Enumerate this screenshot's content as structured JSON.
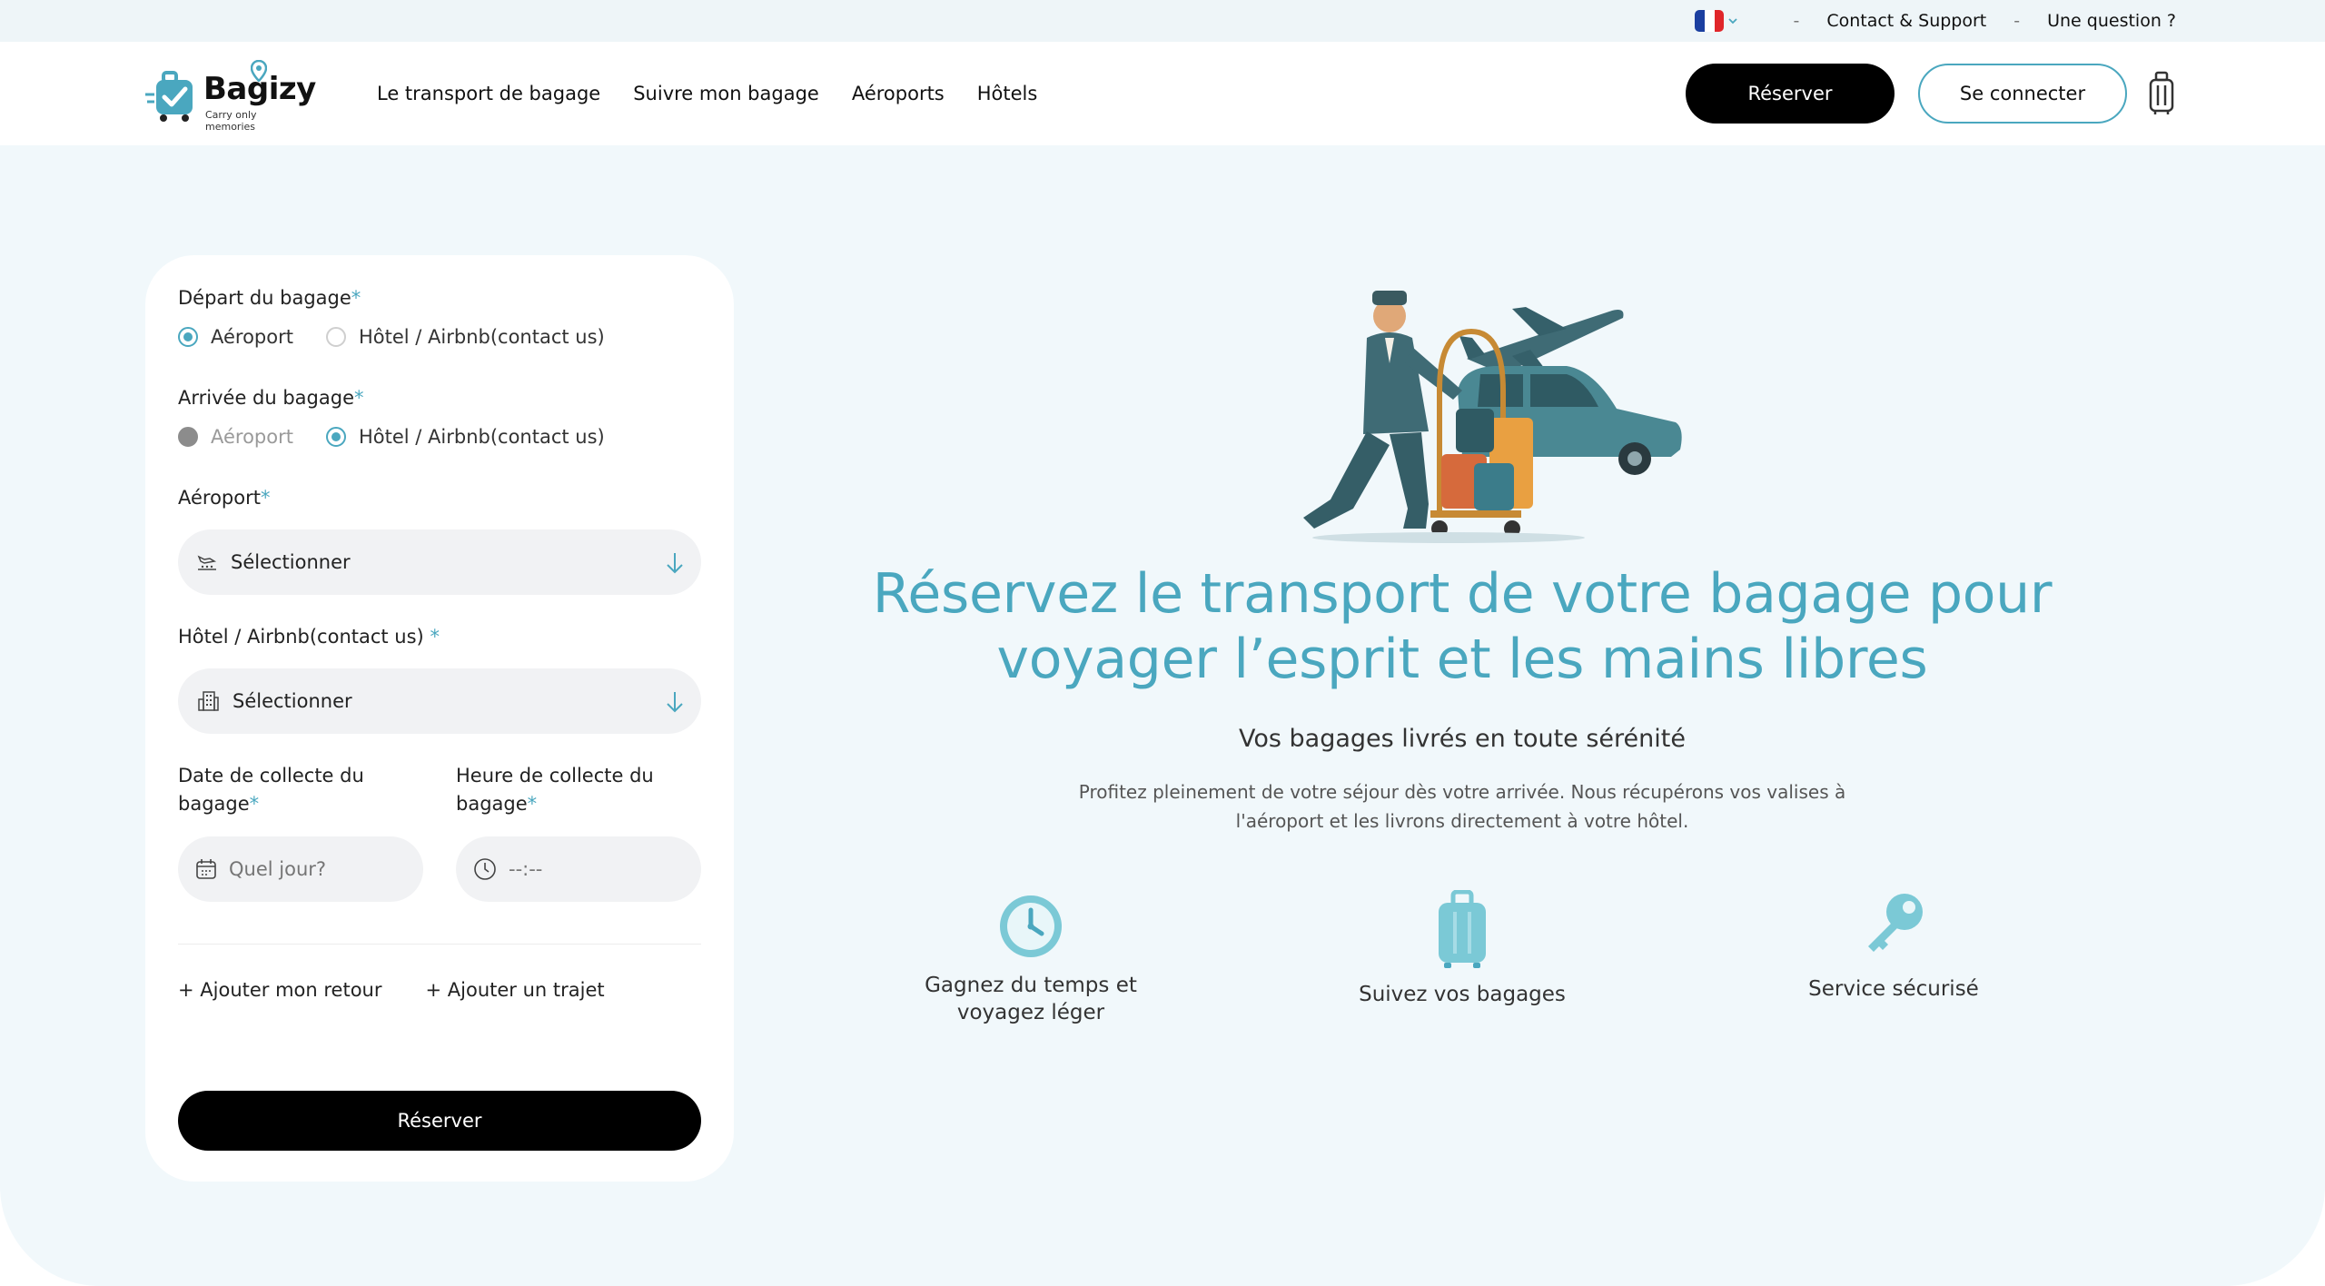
{
  "topbar": {
    "flag_colors": [
      "#1b3fa0",
      "#ffffff",
      "#e0262a"
    ],
    "contact_label": "Contact & Support",
    "question_label": "Une question ?",
    "separator": "-"
  },
  "header": {
    "logo_text": "Bagizy",
    "logo_tagline": "Carry only memories",
    "nav": [
      "Le transport de bagage",
      "Suivre mon bagage",
      "Aéroports",
      "Hôtels"
    ],
    "reserve_label": "Réserver",
    "login_label": "Se connecter"
  },
  "form": {
    "departure_label": "Départ du bagage",
    "departure_options": [
      "Aéroport",
      "Hôtel / Airbnb(contact us)"
    ],
    "departure_selected": "Aéroport",
    "arrival_label": "Arrivée du bagage",
    "arrival_options": [
      "Aéroport",
      "Hôtel / Airbnb(contact us)"
    ],
    "arrival_selected": "Hôtel / Airbnb(contact us)",
    "airport_label": "Aéroport",
    "airport_value": "Sélectionner",
    "hotel_label": "Hôtel / Airbnb(contact us) ",
    "hotel_value": "Sélectionner",
    "date_label_1": "Date de collecte du",
    "date_label_2": "bagage",
    "date_placeholder": "Quel jour?",
    "time_label_1": "Heure de collecte du",
    "time_label_2": "bagage",
    "time_placeholder": "--:--",
    "required_mark": "*",
    "add_return": "+ Ajouter mon retour",
    "add_trip": "+ Ajouter un trajet",
    "submit_label": "Réserver"
  },
  "hero": {
    "title_line1": "Réservez le transport de votre bagage pour",
    "title_line2": "voyager l’esprit et les mains libres",
    "subtitle": "Vos bagages livrés en toute sérénité",
    "desc_line1": "Profitez pleinement de votre séjour dès votre arrivée. Nous récupérons vos valises à",
    "desc_line2": "l'aéroport et les livrons directement à votre hôtel.",
    "features": [
      {
        "line1": "Gagnez du temps et",
        "line2": "voyagez léger",
        "icon": "clock-icon"
      },
      {
        "line1": "Suivez vos bagages",
        "line2": "",
        "icon": "suitcase-icon"
      },
      {
        "line1": "Service sécurisé",
        "line2": "",
        "icon": "key-icon"
      }
    ],
    "accent_color": "#4aa7bf"
  }
}
